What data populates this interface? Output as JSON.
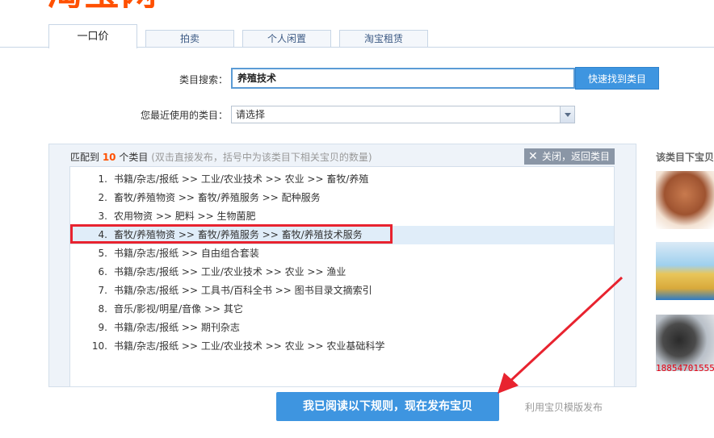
{
  "logo": {
    "text": "淘宝网"
  },
  "tabs": [
    {
      "label": "一口价",
      "active": true
    },
    {
      "label": "拍卖"
    },
    {
      "label": "个人闲置"
    },
    {
      "label": "淘宝租赁"
    }
  ],
  "search": {
    "label": "类目搜索：",
    "value": "养殖技术",
    "button_label": "快速找到类目"
  },
  "recent": {
    "label": "您最近使用的类目：",
    "selected": "请选择"
  },
  "results": {
    "prefix": "匹配到 ",
    "count": "10",
    "suffix": " 个类目",
    "hint": "(双击直接发布，括号中为该类目下相关宝贝的数量)",
    "close_label": "关闭，返回类目",
    "items": [
      {
        "num": "1.",
        "text": "书籍/杂志/报纸 >> 工业/农业技术 >> 农业 >> 畜牧/养殖"
      },
      {
        "num": "2.",
        "text": "畜牧/养殖物资 >> 畜牧/养殖服务 >> 配种服务"
      },
      {
        "num": "3.",
        "text": "农用物资 >> 肥料 >> 生物菌肥"
      },
      {
        "num": "4.",
        "text": "畜牧/养殖物资 >> 畜牧/养殖服务 >> 畜牧/养殖技术服务",
        "selected": true
      },
      {
        "num": "5.",
        "text": "书籍/杂志/报纸 >> 自由组合套装"
      },
      {
        "num": "6.",
        "text": "书籍/杂志/报纸 >> 工业/农业技术 >> 农业 >> 渔业"
      },
      {
        "num": "7.",
        "text": "书籍/杂志/报纸 >> 工具书/百科全书 >> 图书目录文摘索引"
      },
      {
        "num": "8.",
        "text": "音乐/影视/明星/音像 >> 其它"
      },
      {
        "num": "9.",
        "text": "书籍/杂志/报纸 >> 期刊杂志"
      },
      {
        "num": "10.",
        "text": "书籍/杂志/报纸 >> 工业/农业技术 >> 农业 >> 农业基础科学"
      }
    ]
  },
  "right_panel": {
    "title": "该类目下宝贝",
    "phone": "18854701555"
  },
  "actions": {
    "publish_label": "我已阅读以下规则，现在发布宝贝",
    "template_label": "利用宝贝模版发布"
  },
  "colors": {
    "accent": "#ff5000",
    "primary_button": "#3e95e0",
    "highlight_red": "#e8232f"
  }
}
